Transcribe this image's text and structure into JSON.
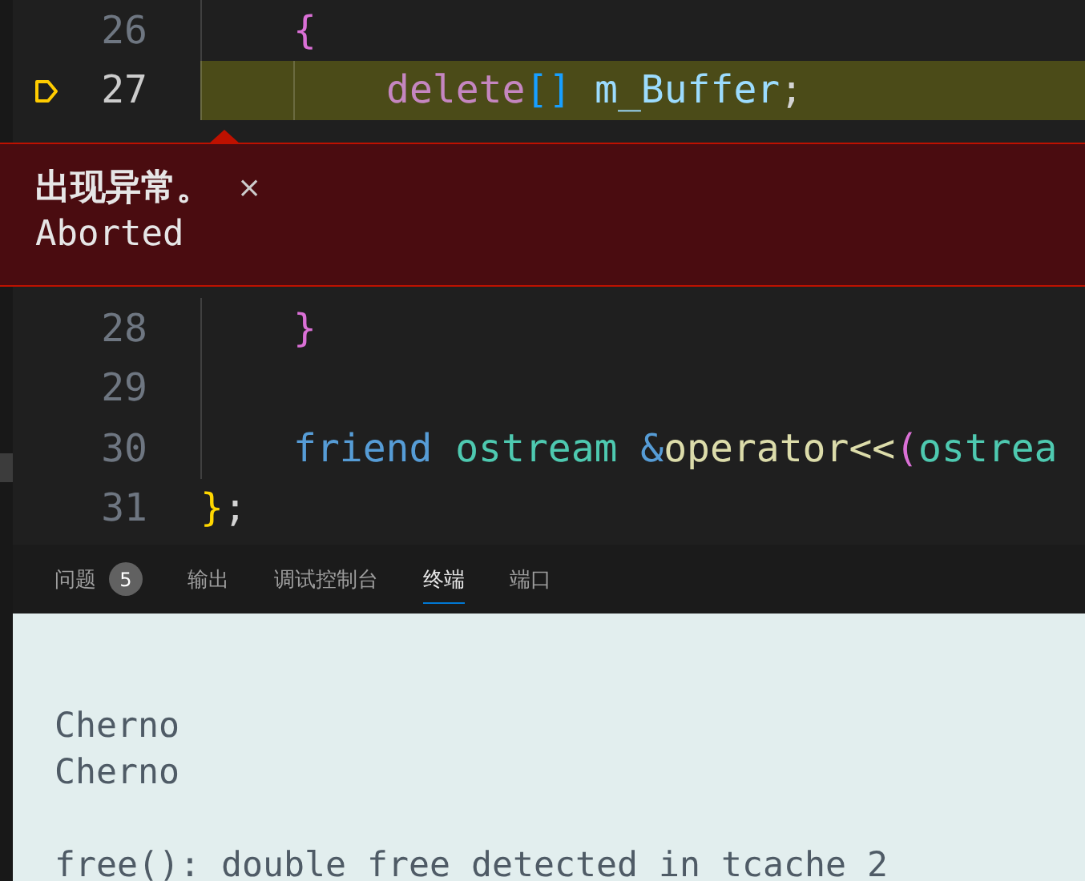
{
  "editor": {
    "lines": [
      {
        "number": "26",
        "current": false,
        "kind": "indent1",
        "tokens": [
          {
            "text": "{",
            "kind": "bracket2"
          }
        ]
      },
      {
        "number": "27",
        "current": true,
        "kind": "indent2",
        "tokens": [
          {
            "text": "delete",
            "kind": "control"
          },
          {
            "text": "[]",
            "kind": "bracket3"
          },
          {
            "text": "m_Buffer",
            "kind": "variable",
            "space_before": true
          },
          {
            "text": ";",
            "kind": "plain"
          }
        ],
        "exception": {
          "title": "出现异常。",
          "close": "×",
          "message": "Aborted"
        }
      },
      {
        "number": "28",
        "current": false,
        "kind": "indent1",
        "tokens": [
          {
            "text": "}",
            "kind": "bracket2"
          }
        ]
      },
      {
        "number": "29",
        "current": false,
        "kind": "indent1"
      },
      {
        "number": "30",
        "current": false,
        "kind": "indent1",
        "tokens": [
          {
            "text": "friend",
            "kind": "keyword"
          },
          {
            "text": "ostream",
            "kind": "type",
            "space_before": true
          },
          {
            "text": "&",
            "kind": "keyword",
            "space_before": true
          },
          {
            "text": "operator<<",
            "kind": "function"
          },
          {
            "text": "(",
            "kind": "bracket2"
          },
          {
            "text": "ostrea",
            "kind": "type"
          }
        ]
      },
      {
        "number": "31",
        "current": false,
        "kind": "flush",
        "tokens": [
          {
            "text": "}",
            "kind": "bracket1"
          },
          {
            "text": ";",
            "kind": "plain"
          }
        ]
      }
    ]
  },
  "panel": {
    "tabs": [
      {
        "label": "问题",
        "badge": "5",
        "selected": false
      },
      {
        "label": "输出",
        "selected": false
      },
      {
        "label": "调试控制台",
        "selected": false
      },
      {
        "label": "终端",
        "selected": true
      },
      {
        "label": "端口",
        "selected": false
      }
    ],
    "terminal": {
      "lines": [
        {
          "text": "Cherno",
          "blank_before": false
        },
        {
          "text": "Cherno",
          "blank_before": false
        },
        {
          "text": "free(): double free detected in tcache 2",
          "blank_before": true
        }
      ]
    }
  }
}
